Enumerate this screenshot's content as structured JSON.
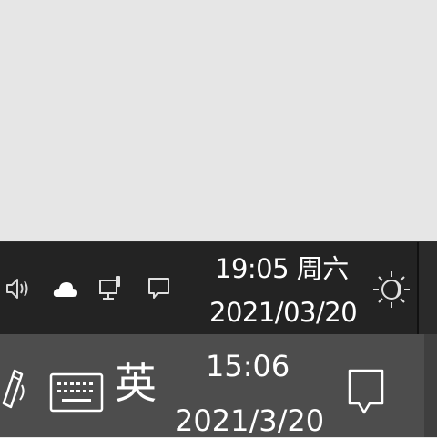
{
  "desktop": {},
  "top_taskbar": {
    "tray_icons": [
      "speaker-icon",
      "onedrive-cloud-icon",
      "network-wired-icon",
      "action-center-icon",
      "night-light-icon"
    ],
    "clock": {
      "time_day": "19:05 周六",
      "date": "2021/03/20"
    },
    "colors": {
      "background": "#232323",
      "text": "#ffffff"
    }
  },
  "bottom_taskbar": {
    "icons": [
      "pen-icon",
      "touch-keyboard-icon",
      "action-center-icon"
    ],
    "input_language": "英",
    "clock": {
      "time": "15:06",
      "date": "2021/3/20"
    },
    "colors": {
      "background": "#4d4d4d",
      "text": "#ffffff"
    }
  }
}
